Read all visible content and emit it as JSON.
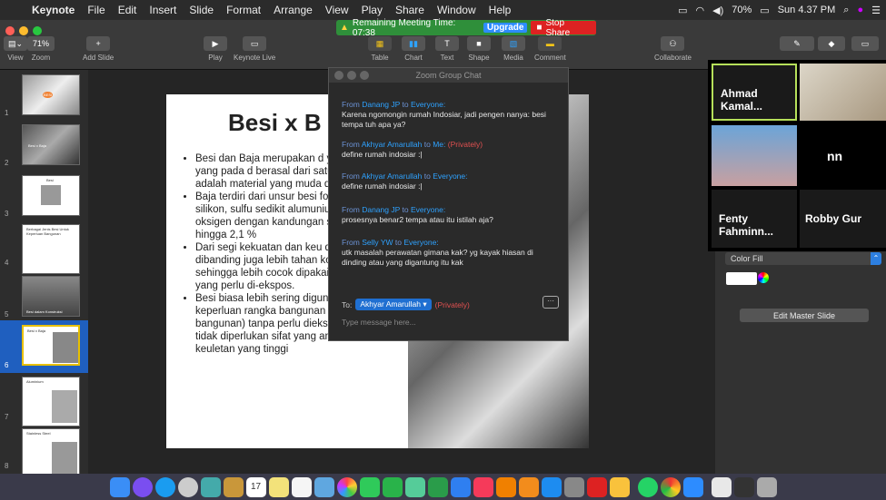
{
  "menubar": {
    "app": "Keynote",
    "items": [
      "File",
      "Edit",
      "Insert",
      "Slide",
      "Format",
      "Arrange",
      "View",
      "Play",
      "Share",
      "Window",
      "Help"
    ],
    "battery": "70%",
    "time": "Sun 4.37 PM"
  },
  "meeting_banner": {
    "text": "Remaining Meeting Time: 07:38",
    "upgrade": "Upgrade",
    "stop": "Stop Share"
  },
  "toolbar": {
    "view": "View",
    "zoom": "Zoom",
    "zoom_value": "71%",
    "add_slide": "Add Slide",
    "play": "Play",
    "keynote_live": "Keynote Live",
    "table": "Table",
    "chart": "Chart",
    "text": "Text",
    "shape": "Shape",
    "media": "Media",
    "comment": "Comment",
    "collaborate": "Collaborate"
  },
  "navigator": {
    "slides": [
      {
        "num": "1",
        "label": "BESI"
      },
      {
        "num": "2",
        "label": "Besi x Baja"
      },
      {
        "num": "3",
        "label": "Besi"
      },
      {
        "num": "4",
        "label": "Berbagai Jenis Besi Untuk Keperluan Bangunan"
      },
      {
        "num": "5",
        "label": "Besi dalam Konstruksi"
      },
      {
        "num": "6",
        "label": "Besi x Baja"
      },
      {
        "num": "7",
        "label": "Aluminium"
      },
      {
        "num": "8",
        "label": "Stainless Steel"
      }
    ]
  },
  "slide": {
    "title": "Besi x B",
    "bullets": [
      "Besi dan Baja merupakan d yang berbeda, yang pada d berasal dari satu unsur (Fe) adalah material yang muda di pasaran.",
      "Baja  terdiri dari unsur besi fosfor, karbon, silikon, sulfu sedikit alumunium, nitrogen oksigen dengan kandungan sebanyak 0,2 hingga 2,1 %",
      "Dari segi kekuatan dan keu dinilai lebih baik dibanding juga lebih tahan korosi diba biasa sehingga lebih cocok dipakai sebagai material yang perlu di-ekspos.",
      "Besi biasa lebih sering digunakan untuk keperluan rangka bangunan (di dalam bangunan) tanpa perlu diekspos, sehingga tidak diperlukan sifat yang anti korosi dan keuletan yang tinggi"
    ]
  },
  "chat": {
    "title": "Zoom Group Chat",
    "messages": [
      {
        "prefix": "From",
        "sender": "Danang JP",
        "to": "to",
        "target": "Everyone:",
        "private": "",
        "text": "Karena ngomongin rumah Indosiar, jadi pengen nanya: besi tempa tuh apa ya?"
      },
      {
        "prefix": "From",
        "sender": "Akhyar Amarullah",
        "to": "to",
        "target": "Me:",
        "private": "(Privately)",
        "text": "define rumah indosiar :|"
      },
      {
        "prefix": "From",
        "sender": "Akhyar Amarullah",
        "to": "to",
        "target": "Everyone:",
        "private": "",
        "text": "define rumah indosiar :|"
      },
      {
        "prefix": "From",
        "sender": "Danang JP",
        "to": "to",
        "target": "Everyone:",
        "private": "",
        "text": "prosesnya benar2 tempa atau itu istilah aja?"
      },
      {
        "prefix": "From",
        "sender": "Selly YW",
        "to": "to",
        "target": "Everyone:",
        "private": "",
        "text": "utk masalah perawatan gimana kak? yg kayak hiasan di dinding atau yang digantung itu kak"
      }
    ],
    "to_label": "To:",
    "to_value": "Akhyar Amarullah",
    "to_private": "(Privately)",
    "input_placeholder": "Type message here..."
  },
  "gallery": {
    "tiles": [
      {
        "name": "Ahmad Kamal..."
      },
      {
        "name": "Fenty Fahminn..."
      },
      {
        "name": "Robby Gur"
      }
    ]
  },
  "inspector": {
    "color_fill": "Color Fill",
    "edit_master": "Edit Master Slide"
  }
}
